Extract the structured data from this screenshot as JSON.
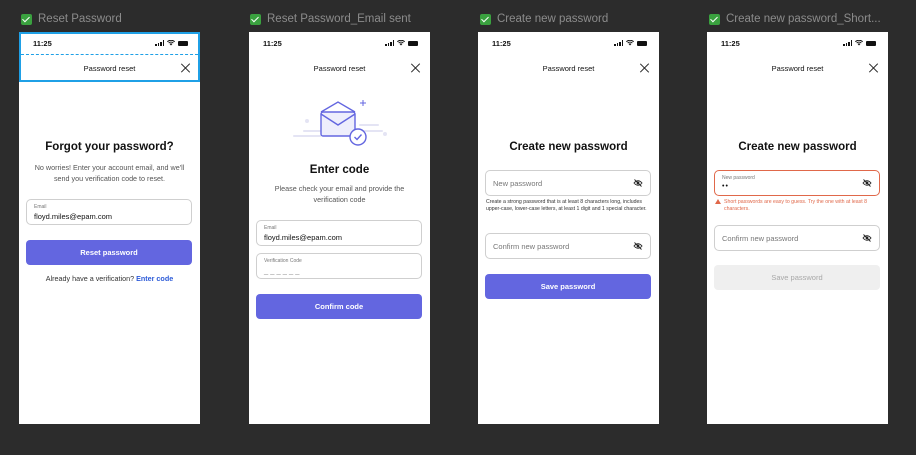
{
  "frames": [
    {
      "label": "Reset Password"
    },
    {
      "label": "Reset Password_Email sent"
    },
    {
      "label": "Create new password"
    },
    {
      "label": "Create new password_Short..."
    }
  ],
  "status_time": "11:25",
  "nav_title": "Password reset",
  "screen1": {
    "heading": "Forgot your password?",
    "subtext": "No worries! Enter your account email, and we'll send you verification code to reset.",
    "email_label": "Email",
    "email_value": "floyd.miles@epam.com",
    "button": "Reset password",
    "footer_text": "Already have a verification?",
    "footer_link": "Enter code"
  },
  "screen2": {
    "heading": "Enter code",
    "subtext": "Please check your email and provide the verification code",
    "email_label": "Email",
    "email_value": "floyd.miles@epam.com",
    "code_label": "Verification Code",
    "code_value": "_ _ _ _ _ _",
    "button": "Confirm code"
  },
  "screen3": {
    "heading": "Create new password",
    "new_placeholder": "New password",
    "hint": "Create a strong password that is at least 8 characters long, includes upper-case, lower-case letters, at least 1 digit and 1 special character.",
    "confirm_placeholder": "Confirm new password",
    "button": "Save password"
  },
  "screen4": {
    "heading": "Create new password",
    "new_label": "New password",
    "new_value": "••",
    "error": "Short passwords are easy to guess. Try the one with at least 8 characters.",
    "confirm_placeholder": "Confirm new password",
    "button": "Save password"
  },
  "colors": {
    "accent": "#6366e0",
    "link": "#2d5bd8",
    "error": "#e0684a",
    "selection": "#1fa0e6",
    "check": "#3aa13f"
  }
}
